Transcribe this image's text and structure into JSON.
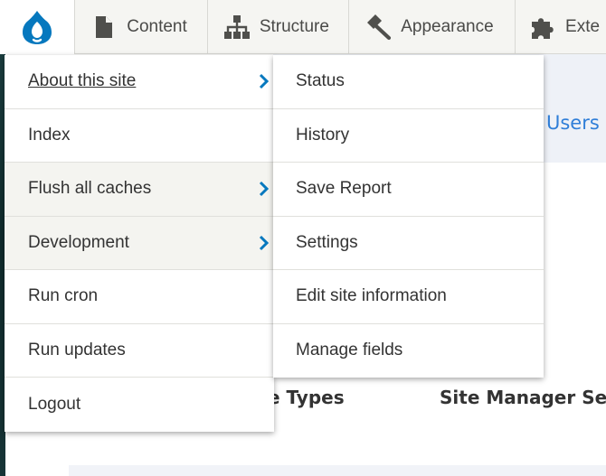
{
  "toolbar": {
    "tabs": [
      {
        "label": "Content",
        "icon": "file-icon"
      },
      {
        "label": "Structure",
        "icon": "structure-icon"
      },
      {
        "label": "Appearance",
        "icon": "paintbrush-icon"
      },
      {
        "label": "Exte",
        "icon": "puzzle-icon"
      }
    ],
    "logo": "drupal-logo"
  },
  "admin_menu": {
    "items": [
      {
        "label": "About this site",
        "has_submenu": true,
        "active": true
      },
      {
        "label": "Index",
        "has_submenu": false
      },
      {
        "label": "Flush all caches",
        "has_submenu": true
      },
      {
        "label": "Development",
        "has_submenu": true
      },
      {
        "label": "Run cron",
        "has_submenu": false
      },
      {
        "label": "Run updates",
        "has_submenu": false
      },
      {
        "label": "Logout",
        "has_submenu": false
      }
    ]
  },
  "submenu": {
    "items": [
      {
        "label": "Status"
      },
      {
        "label": "History"
      },
      {
        "label": "Save Report"
      },
      {
        "label": "Settings"
      },
      {
        "label": "Edit site information"
      },
      {
        "label": "Manage fields"
      }
    ]
  },
  "page": {
    "users_link": "Users",
    "heading_a": "e Types",
    "heading_b": "Site Manager Se"
  },
  "colors": {
    "accent": "#0678be",
    "link": "#2f7ed8",
    "toolbar_bg": "#f5f5f2"
  }
}
